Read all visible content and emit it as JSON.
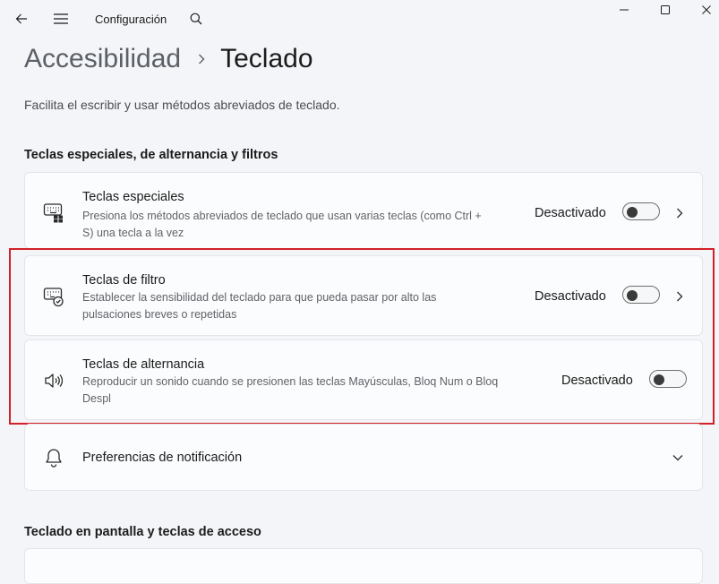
{
  "app": {
    "title": "Configuración",
    "icons": {
      "back": "back-arrow-icon",
      "menu": "hamburger-menu-icon",
      "search": "search-icon",
      "minimize": "minimize-icon",
      "maximize": "maximize-icon",
      "close": "close-icon"
    }
  },
  "breadcrumb": {
    "parent": "Accesibilidad",
    "current": "Teclado"
  },
  "page": {
    "description": "Facilita el escribir y usar métodos abreviados de teclado."
  },
  "sections": {
    "special_title": "Teclas especiales, de alternancia y filtros",
    "onscreen_title": "Teclado en pantalla y teclas de acceso"
  },
  "settings": {
    "special_keys": {
      "title": "Teclas especiales",
      "description_line1": "Presiona los métodos abreviados de teclado que usan varias teclas (como Ctrl +",
      "description_line2": "S) una tecla a la vez",
      "state": "Desactivado",
      "toggle_on": false,
      "icon": "keyboard-sticky-keys-icon"
    },
    "filter_keys": {
      "title": "Teclas de filtro",
      "description_line1": "Establecer la sensibilidad del teclado para que pueda pasar por alto las",
      "description_line2": "pulsaciones breves o repetidas",
      "state": "Desactivado",
      "toggle_on": false,
      "icon": "keyboard-filter-keys-icon"
    },
    "toggle_keys": {
      "title": "Teclas de alternancia",
      "description_line1": "Reproducir un sonido cuando se presionen las teclas Mayúsculas, Bloq Num o Bloq",
      "description_line2": "Despl",
      "state": "Desactivado",
      "toggle_on": false,
      "icon": "speaker-icon"
    },
    "notification_prefs": {
      "title": "Preferencias de notificación",
      "icon": "bell-icon"
    }
  },
  "colors": {
    "background": "#f3f5f8",
    "card": "#fbfcfd",
    "highlight_border": "#d32028"
  }
}
